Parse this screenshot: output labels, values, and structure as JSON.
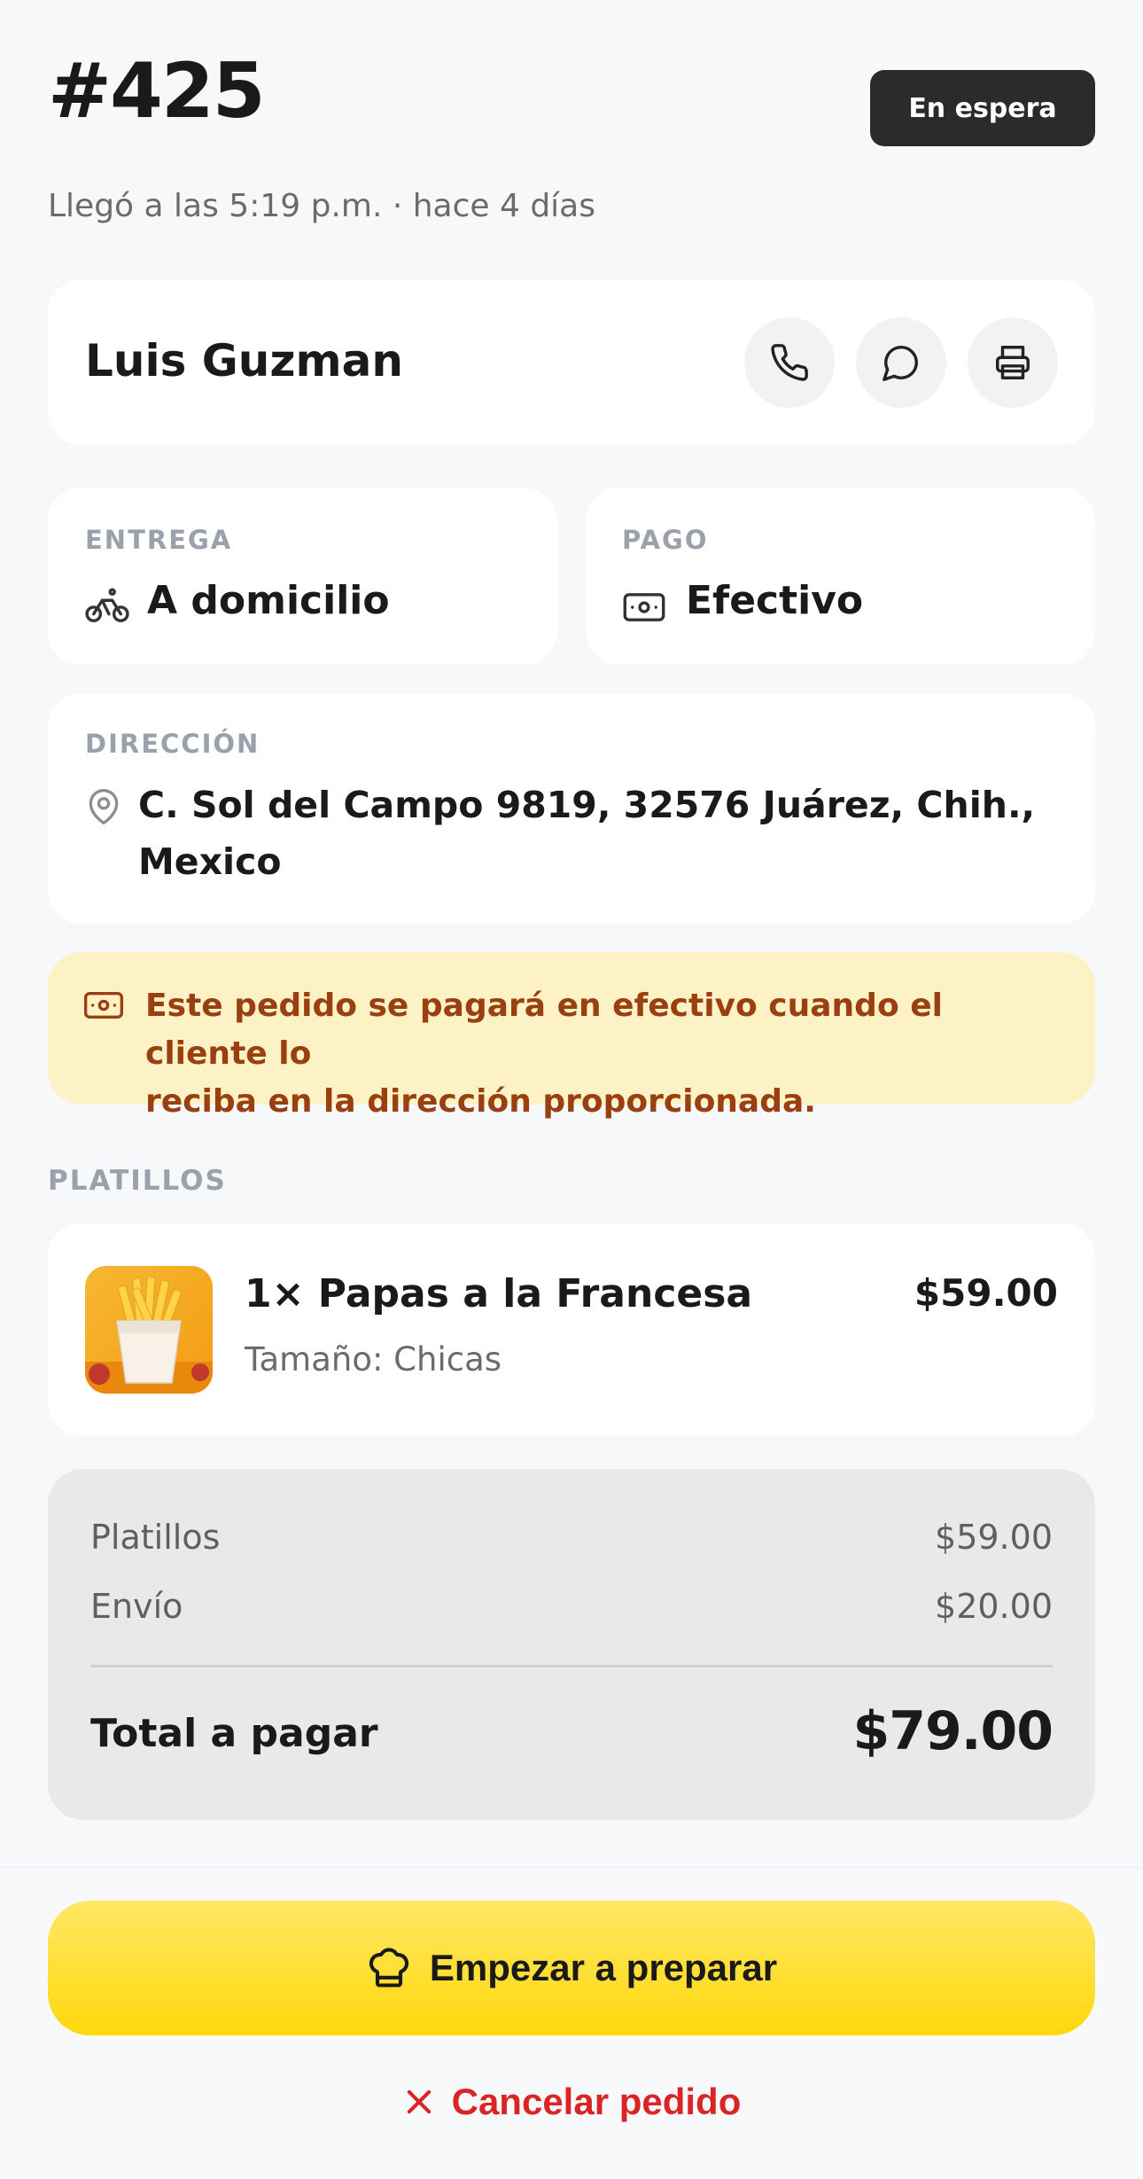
{
  "header": {
    "order_number": "#425",
    "status": "En espera",
    "arrival": "Llegó a las 5:19 p.m. · hace 4 días"
  },
  "customer": {
    "name": "Luis Guzman",
    "actions": [
      "phone-icon",
      "chat-icon",
      "printer-icon"
    ]
  },
  "delivery": {
    "label": "ENTREGA",
    "value": "A domicilio",
    "icon": "bicycle-icon"
  },
  "payment": {
    "label": "PAGO",
    "value": "Efectivo",
    "icon": "cash-icon"
  },
  "address": {
    "label": "DIRECCIÓN",
    "line1": "C. Sol del Campo 9819, 32576 Juárez, Chih.,",
    "line2": "Mexico",
    "icon": "location-pin-icon"
  },
  "notice": {
    "icon": "cash-icon",
    "line1": "Este pedido se pagará en efectivo cuando el cliente lo",
    "line2": "reciba en la dirección proporcionada."
  },
  "items_section": {
    "label": "PLATILLOS",
    "items": [
      {
        "name": "1× Papas a la Francesa",
        "price": "$59.00",
        "option": "Tamaño: Chicas",
        "image": "french-fries"
      }
    ]
  },
  "totals": {
    "subtotal_label": "Platillos",
    "subtotal_value": "$59.00",
    "shipping_label": "Envío",
    "shipping_value": "$20.00",
    "total_label": "Total a pagar",
    "total_value": "$79.00"
  },
  "actions": {
    "primary": "Empezar a preparar",
    "primary_icon": "chef-hat-icon",
    "secondary": "Cancelar pedido",
    "secondary_icon": "close-icon"
  },
  "colors": {
    "accent": "#ffd80a",
    "badge_bg": "#2b2b2b",
    "notice_bg": "#fdf1c6",
    "notice_text": "#9a3f10",
    "danger": "#d92525"
  }
}
